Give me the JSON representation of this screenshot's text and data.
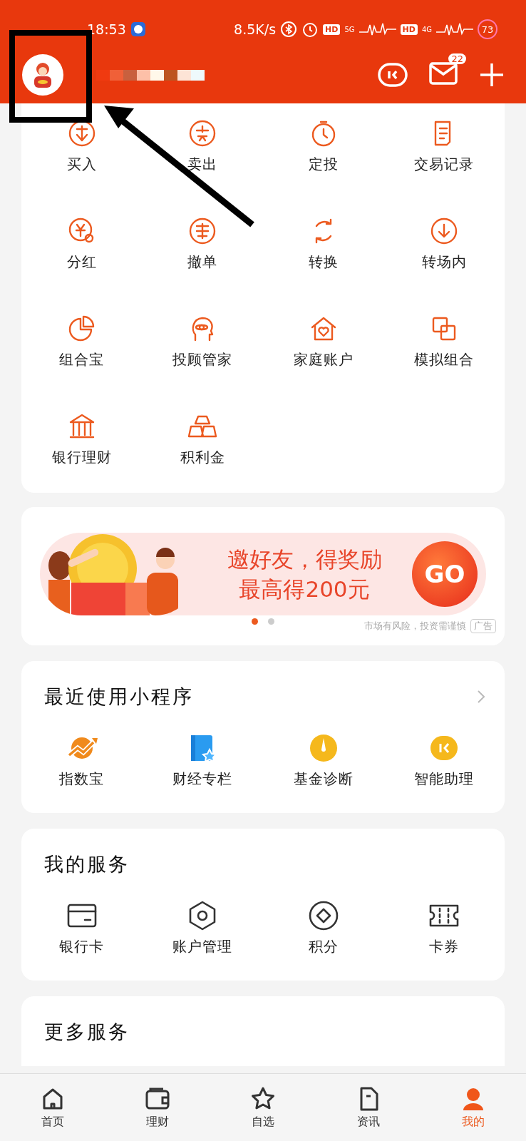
{
  "status_bar": {
    "time": "18:53",
    "speed": "8.5K/s",
    "badges": [
      "HD",
      "HD"
    ],
    "networks": [
      "5G",
      "4G"
    ],
    "battery": "73"
  },
  "header": {
    "message_count": "22"
  },
  "quick_actions": [
    {
      "label": "买入"
    },
    {
      "label": "卖出"
    },
    {
      "label": "定投"
    },
    {
      "label": "交易记录"
    },
    {
      "label": "分红"
    },
    {
      "label": "撤单"
    },
    {
      "label": "转换"
    },
    {
      "label": "转场内"
    },
    {
      "label": "组合宝"
    },
    {
      "label": "投顾管家"
    },
    {
      "label": "家庭账户"
    },
    {
      "label": "模拟组合"
    },
    {
      "label": "银行理财"
    },
    {
      "label": "积利金"
    }
  ],
  "banner": {
    "line_1": "邀好友，得奖励",
    "line_2": "最高得200元",
    "button": "GO",
    "dots": [
      {
        "selected": true
      },
      {
        "selected": false
      }
    ],
    "disclaimer": "市场有风险，投资需谨慎",
    "ad_tag": "广告"
  },
  "recent_mini_programs": {
    "title": "最近使用小程序",
    "items": [
      {
        "label": "指数宝"
      },
      {
        "label": "财经专栏"
      },
      {
        "label": "基金诊断"
      },
      {
        "label": "智能助理"
      }
    ]
  },
  "my_services": {
    "title": "我的服务",
    "items": [
      {
        "label": "银行卡"
      },
      {
        "label": "账户管理"
      },
      {
        "label": "积分"
      },
      {
        "label": "卡券"
      }
    ]
  },
  "more_services": {
    "title": "更多服务"
  },
  "bottom_nav": [
    {
      "label": "首页",
      "selected": false
    },
    {
      "label": "理财",
      "selected": false
    },
    {
      "label": "自选",
      "selected": false
    },
    {
      "label": "资讯",
      "selected": false
    },
    {
      "label": "我的",
      "selected": true
    }
  ]
}
